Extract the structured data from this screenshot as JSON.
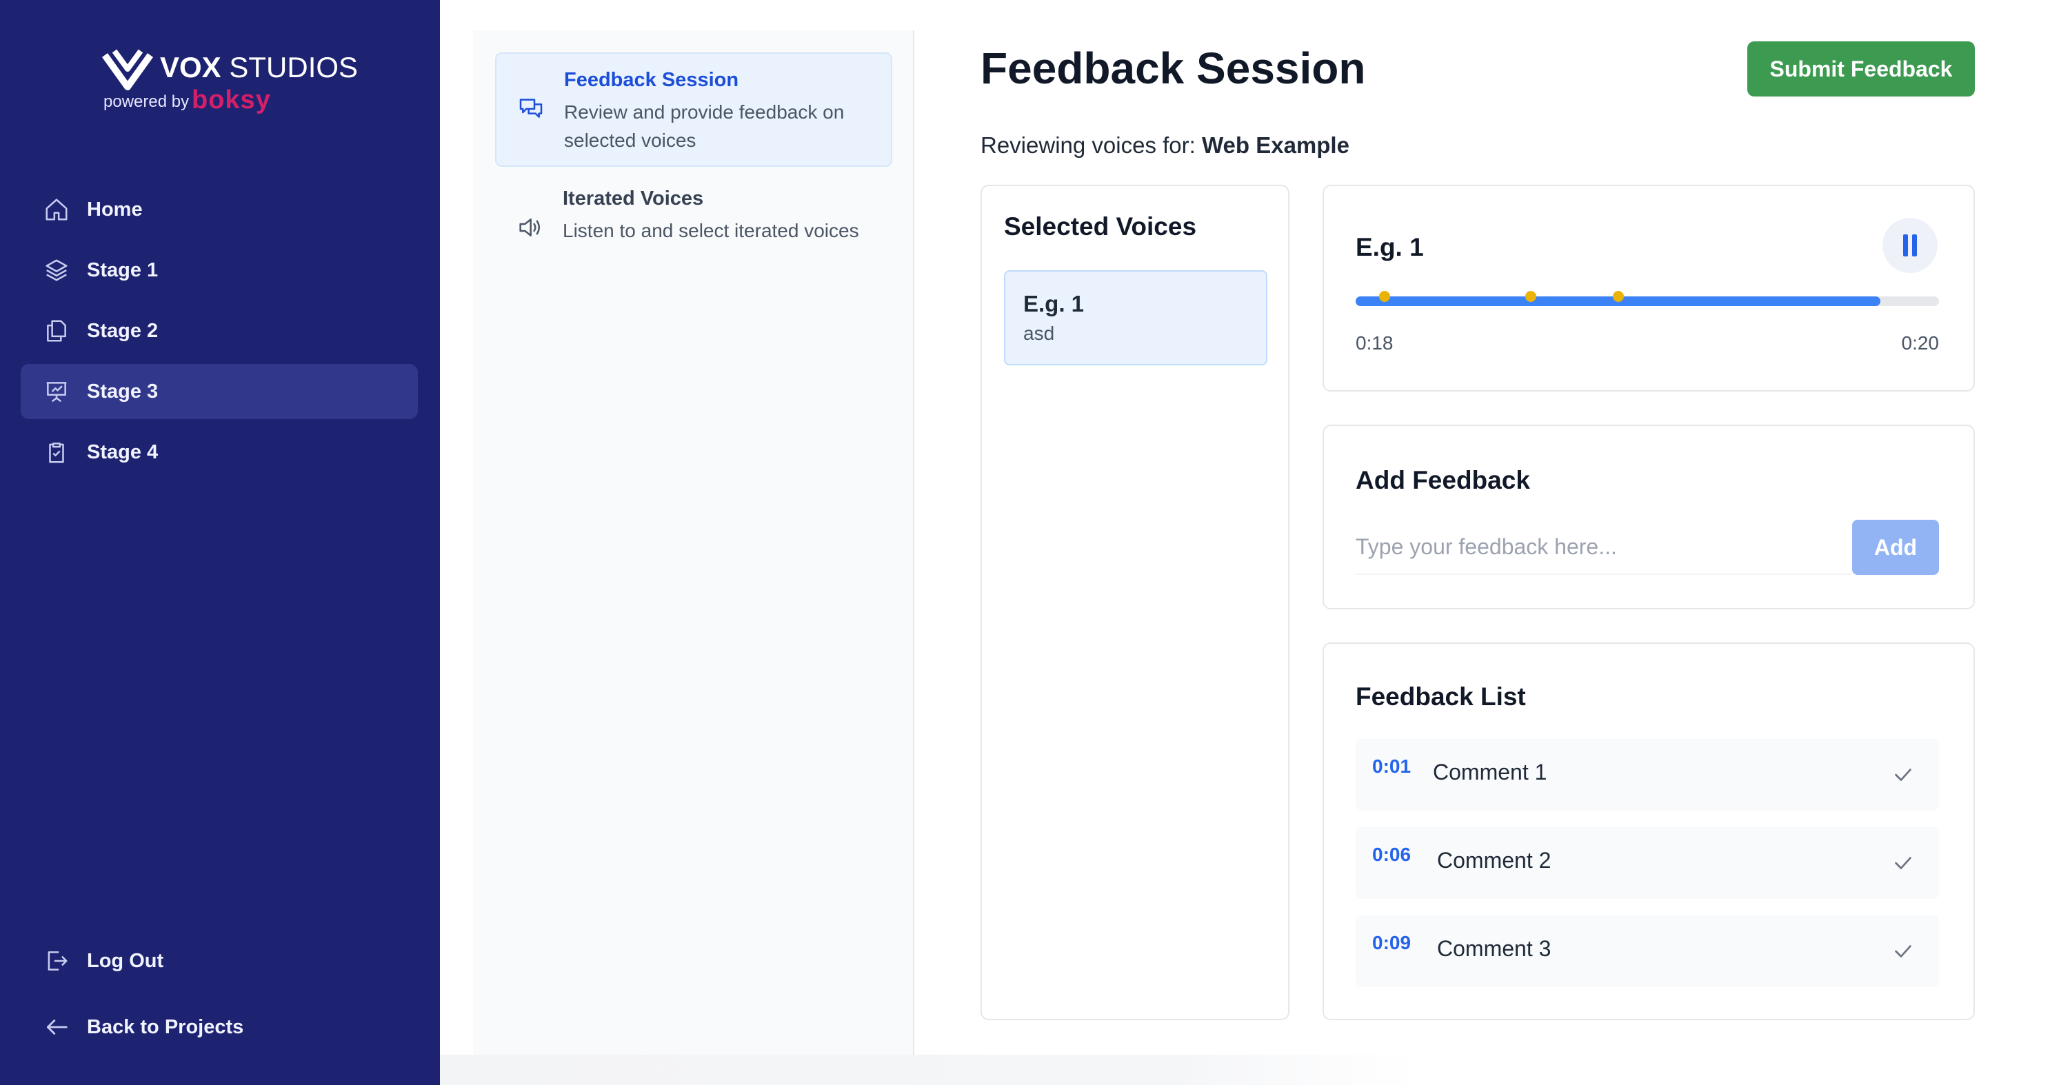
{
  "brand": {
    "name_bold": "VOX",
    "name_regular": "STUDIOS",
    "powered_by": "powered by",
    "powered_brand": "boksy"
  },
  "sidebar": {
    "items": [
      {
        "label": "Home",
        "icon": "home-icon"
      },
      {
        "label": "Stage 1",
        "icon": "layers-icon"
      },
      {
        "label": "Stage 2",
        "icon": "copy-icon"
      },
      {
        "label": "Stage 3",
        "icon": "presentation-icon",
        "active": true
      },
      {
        "label": "Stage 4",
        "icon": "clipboard-icon"
      }
    ],
    "logout": "Log Out",
    "back": "Back to Projects"
  },
  "subnav": {
    "items": [
      {
        "title": "Feedback Session",
        "desc": "Review and provide feedback on selected voices",
        "icon": "chat-bubbles-icon",
        "active": true
      },
      {
        "title": "Iterated Voices",
        "desc": "Listen to and select iterated voices",
        "icon": "speaker-icon"
      }
    ]
  },
  "main": {
    "title": "Feedback Session",
    "submit_label": "Submit Feedback",
    "reviewing_prefix": "Reviewing voices for:",
    "project_name": "Web Example"
  },
  "selected_voices": {
    "title": "Selected Voices",
    "items": [
      {
        "name": "E.g. 1",
        "desc": "asd"
      }
    ]
  },
  "player": {
    "voice_name": "E.g. 1",
    "state": "playing",
    "current_time": "0:18",
    "total_time": "0:20",
    "progress_fraction": 0.9,
    "marker_times_seconds": [
      1,
      6,
      9
    ],
    "duration_seconds": 20
  },
  "add_feedback": {
    "title": "Add Feedback",
    "placeholder": "Type your feedback here...",
    "value": "",
    "add_label": "Add"
  },
  "feedback_list": {
    "title": "Feedback List",
    "items": [
      {
        "time": "0:01",
        "text": "Comment 1"
      },
      {
        "time": "0:06",
        "text": "Comment 2"
      },
      {
        "time": "0:09",
        "text": "Comment 3"
      }
    ]
  },
  "colors": {
    "sidebar_bg": "#1d2271",
    "submit_green": "#3d9a51",
    "accent_blue": "#2563eb",
    "marker_yellow": "#eab308",
    "brand_pink": "#d61f69"
  }
}
